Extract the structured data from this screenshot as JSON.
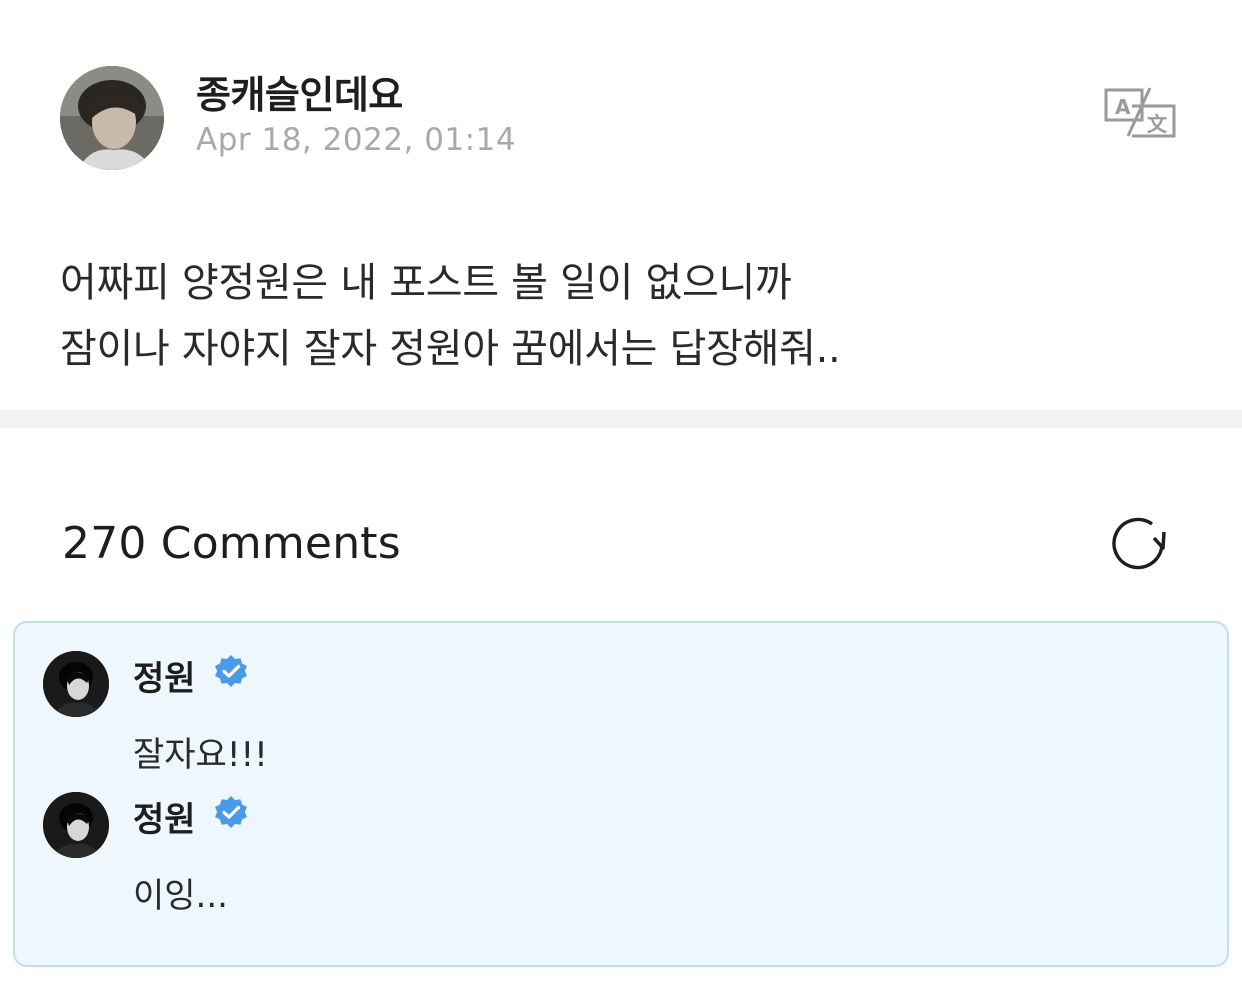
{
  "post": {
    "author": "종캐슬인데요",
    "date": "Apr 18, 2022, 01:14",
    "body_lines": [
      "어짜피 양정원은 내 포스트 볼 일이 없으니까",
      "잠이나 자야지 잘자 정원아 꿈에서는 답장해줘.."
    ],
    "icons": {
      "translate": "translate-icon",
      "avatar": "author-avatar"
    }
  },
  "comments_section": {
    "count_label": "270 Comments",
    "refresh_icon": "refresh-icon"
  },
  "comments": [
    {
      "name": "정원",
      "text": "잘자요!!!",
      "verified": true
    },
    {
      "name": "정원",
      "text": "이잉...",
      "verified": true
    }
  ],
  "colors": {
    "highlight_bg": "#edf7fd",
    "highlight_border": "#bde0f3",
    "verified_blue": "#4b9ae8",
    "date_gray": "#a9a9a9"
  }
}
